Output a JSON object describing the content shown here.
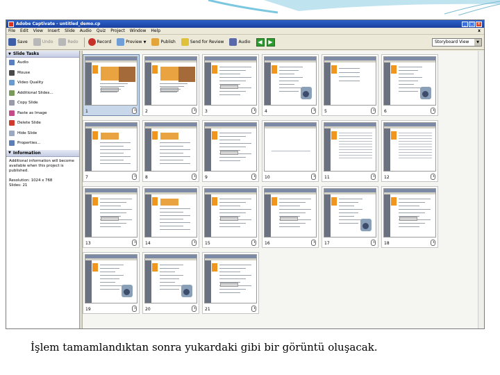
{
  "window": {
    "title": "Adobe Captivate - untitled_demo.cp",
    "controls": [
      "_",
      "□",
      "×"
    ]
  },
  "menu": [
    "File",
    "Edit",
    "View",
    "Insert",
    "Slide",
    "Audio",
    "Quiz",
    "Project",
    "Window",
    "Help"
  ],
  "menu_close": "x",
  "toolbar": {
    "buttons": [
      {
        "label": "Save",
        "icon": "save-icon",
        "disabled": false
      },
      {
        "label": "Undo",
        "icon": "undo-icon",
        "disabled": true
      },
      {
        "label": "Redo",
        "icon": "redo-icon",
        "disabled": true
      },
      {
        "label": "Record",
        "icon": "record-icon",
        "disabled": false
      },
      {
        "label": "Preview",
        "icon": "preview-icon",
        "disabled": false
      },
      {
        "label": "Publish",
        "icon": "publish-icon",
        "disabled": false
      },
      {
        "label": "Send for Review",
        "icon": "send-review-icon",
        "disabled": false
      },
      {
        "label": "Audio",
        "icon": "audio-icon",
        "disabled": false
      }
    ],
    "view_select": "Storyboard View"
  },
  "slide_tasks": {
    "title": "Slide Tasks",
    "items": [
      {
        "label": "Audio",
        "color": "#5a7fbf"
      },
      {
        "label": "Mouse",
        "color": "#4a4a4a"
      },
      {
        "label": "Video Quality",
        "color": "#6a9ad0"
      },
      {
        "label": "Additional Slides...",
        "color": "#7a9a5a"
      },
      {
        "label": "Copy Slide",
        "color": "#9a9aa8"
      },
      {
        "label": "Paste as Image",
        "color": "#c44a8a"
      },
      {
        "label": "Delete Slide",
        "color": "#d0392b"
      },
      {
        "label": "Hide Slide",
        "color": "#9aa8c4"
      },
      {
        "label": "Properties...",
        "color": "#5b7fb5"
      }
    ]
  },
  "information": {
    "title": "Information",
    "note": "Additional information will become available when this project is published.",
    "resolution": "Resolution: 1024 x 768",
    "slides": "Slides: 21"
  },
  "slides": [
    {
      "num": "1",
      "style": "photo",
      "selected": true
    },
    {
      "num": "2",
      "style": "photo",
      "selected": false
    },
    {
      "num": "3",
      "style": "text",
      "selected": false
    },
    {
      "num": "4",
      "style": "camera",
      "selected": false
    },
    {
      "num": "5",
      "style": "plain",
      "selected": false
    },
    {
      "num": "6",
      "style": "camera",
      "selected": false
    },
    {
      "num": "7",
      "style": "orange",
      "selected": false
    },
    {
      "num": "8",
      "style": "orange",
      "selected": false
    },
    {
      "num": "9",
      "style": "text",
      "selected": false
    },
    {
      "num": "10",
      "style": "blank",
      "selected": false
    },
    {
      "num": "11",
      "style": "table",
      "selected": false
    },
    {
      "num": "12",
      "style": "table",
      "selected": false
    },
    {
      "num": "13",
      "style": "text",
      "selected": false
    },
    {
      "num": "14",
      "style": "orange",
      "selected": false
    },
    {
      "num": "15",
      "style": "text",
      "selected": false
    },
    {
      "num": "16",
      "style": "text",
      "selected": false
    },
    {
      "num": "17",
      "style": "camera",
      "selected": false
    },
    {
      "num": "18",
      "style": "text",
      "selected": false
    },
    {
      "num": "19",
      "style": "camera",
      "selected": false
    },
    {
      "num": "20",
      "style": "camera",
      "selected": false
    },
    {
      "num": "21",
      "style": "text",
      "selected": false
    }
  ],
  "caption": "İşlem tamamlandıktan sonra  yukardaki gibi bir görüntü oluşacak."
}
